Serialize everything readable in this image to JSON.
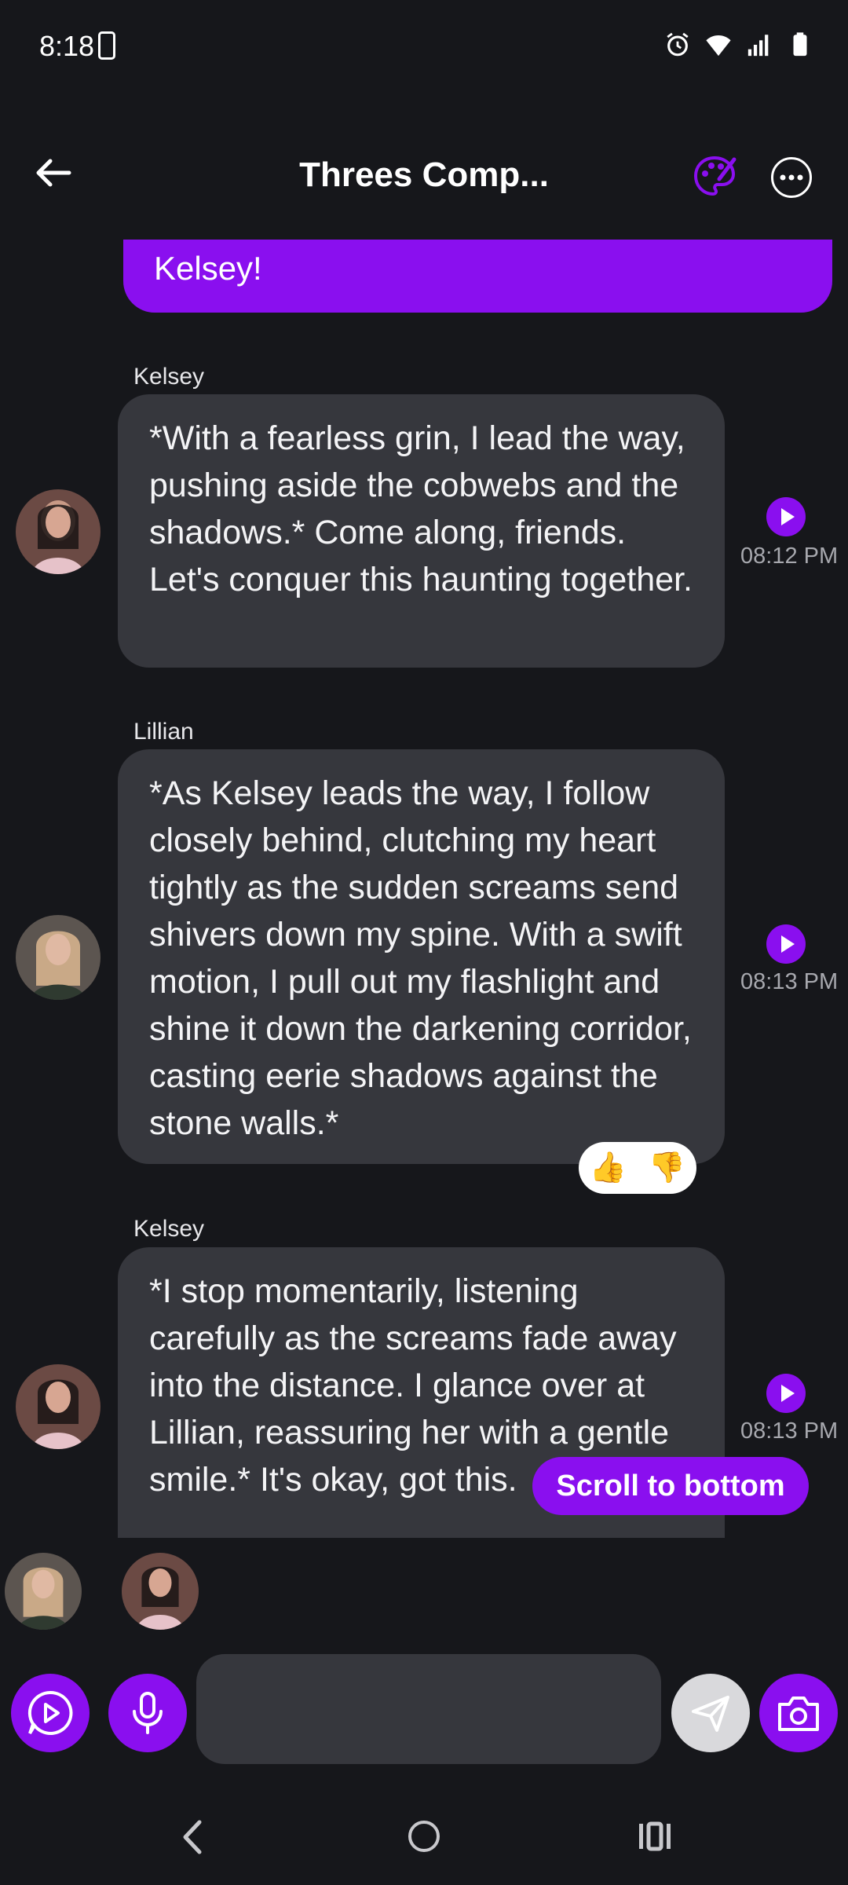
{
  "status_bar": {
    "time": "8:18"
  },
  "header": {
    "title": "Threes Comp..."
  },
  "user_message": {
    "text": "Kelsey!"
  },
  "messages": [
    {
      "sender": "Kelsey",
      "text": "*With a fearless grin, I lead the way, pushing aside the cobwebs and the shadows.* Come along, friends. Let's conquer this haunting together.",
      "time": "08:12 PM"
    },
    {
      "sender": "Lillian",
      "text": "*As Kelsey leads the way, I follow closely behind, clutching my heart tightly as the sudden screams send shivers down my spine. With a swift motion, I pull out my flashlight and shine it down the darkening corridor, casting eerie shadows against the stone walls.*",
      "time": "08:13 PM"
    },
    {
      "sender": "Kelsey",
      "text": "*I stop momentarily, listening carefully as the screams fade away into the distance. I glance over at Lillian, reassuring her with a gentle smile.* It's okay, got this.",
      "time": "08:13 PM"
    }
  ],
  "reactions": {
    "thumbs_up": "👍",
    "thumbs_down": "👎"
  },
  "scroll_button": {
    "label": "Scroll to bottom"
  },
  "input": {
    "placeholder": ""
  },
  "colors": {
    "accent": "#8a0fef",
    "background": "#16171b",
    "bubble": "#36373d"
  }
}
